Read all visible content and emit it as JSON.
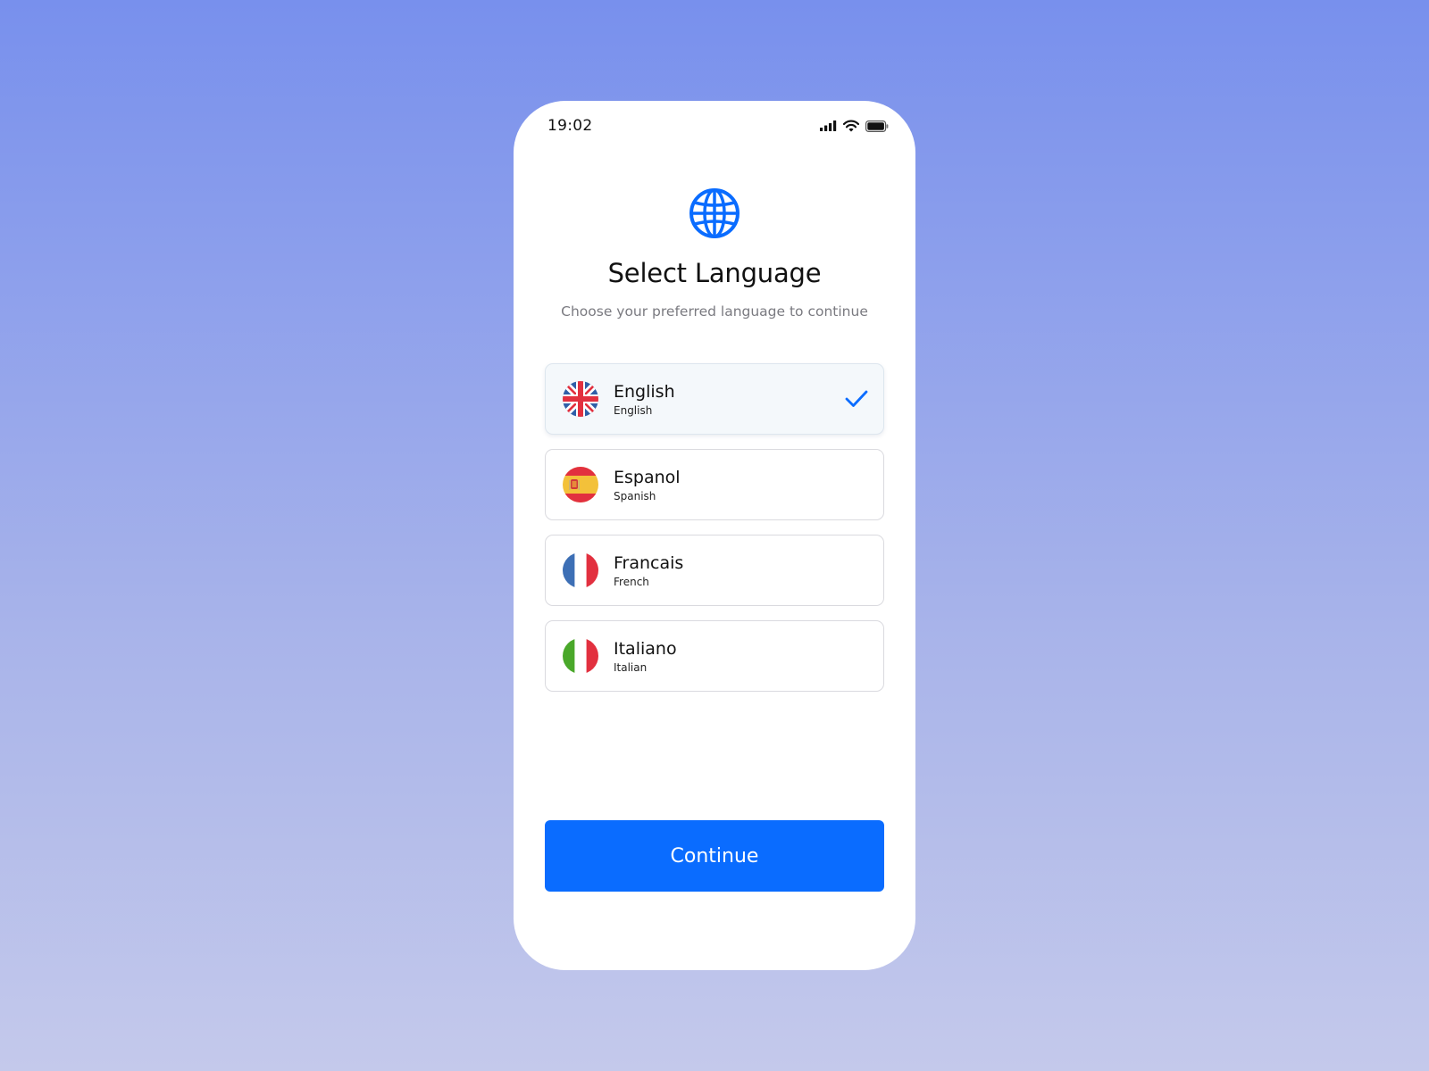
{
  "status_bar": {
    "time": "19:02",
    "icons": [
      "cellular-signal-icon",
      "wifi-icon",
      "battery-icon"
    ]
  },
  "header": {
    "icon": "globe-icon",
    "title": "Select Language",
    "subtitle": "Choose your preferred language to continue"
  },
  "languages": [
    {
      "name": "English",
      "native": "English",
      "flag": "uk-flag-icon",
      "selected": true
    },
    {
      "name": "Espanol",
      "native": "Spanish",
      "flag": "spain-flag-icon",
      "selected": false
    },
    {
      "name": "Francais",
      "native": "French",
      "flag": "france-flag-icon",
      "selected": false
    },
    {
      "name": "Italiano",
      "native": "Italian",
      "flag": "italy-flag-icon",
      "selected": false
    }
  ],
  "continue_label": "Continue",
  "colors": {
    "accent": "#0a6cff",
    "title": "#111111",
    "subtitle": "#7a7a80",
    "selected_bg": "#f4f8fb",
    "card_border": "#dadadf"
  }
}
